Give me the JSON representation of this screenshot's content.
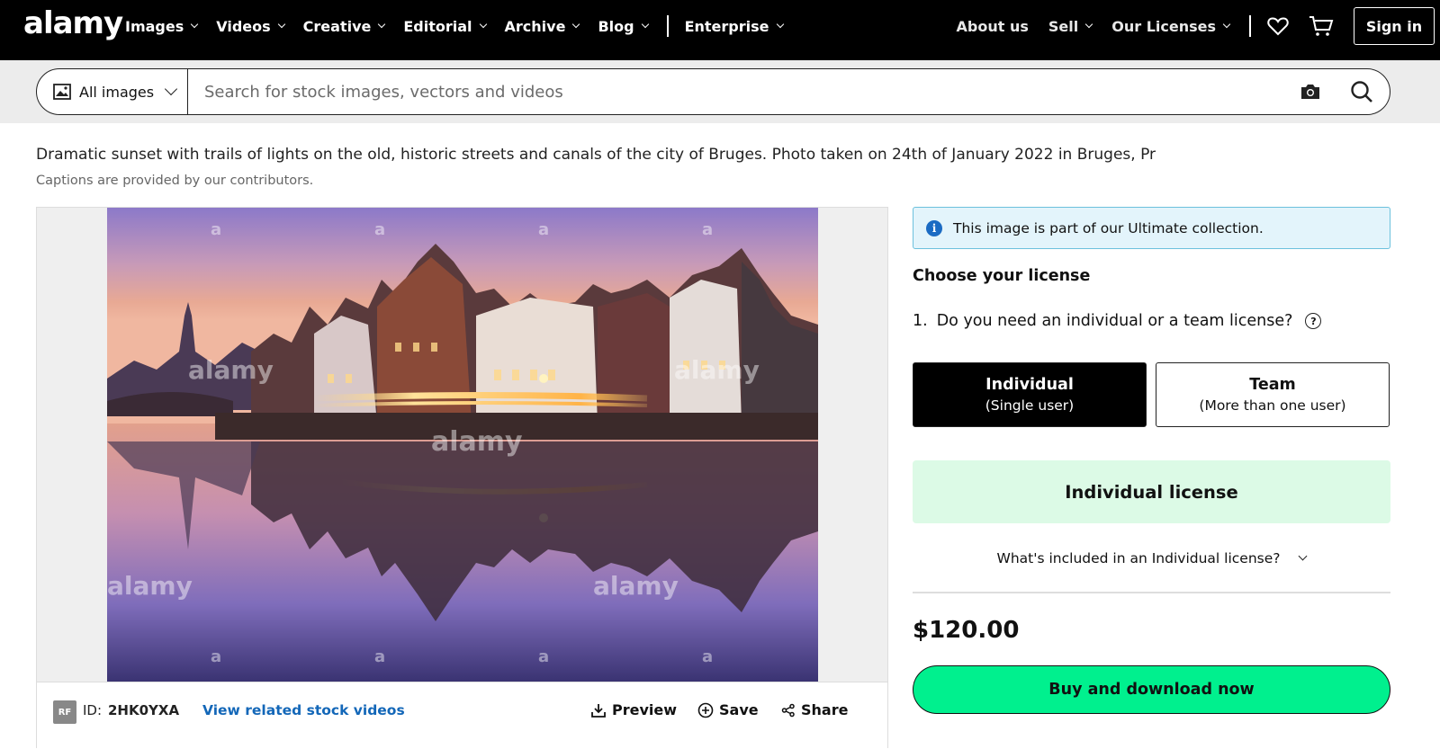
{
  "brand": {
    "logo_text": "alamy"
  },
  "nav": {
    "items": [
      {
        "label": "Images"
      },
      {
        "label": "Videos"
      },
      {
        "label": "Creative"
      },
      {
        "label": "Editorial"
      },
      {
        "label": "Archive"
      },
      {
        "label": "Blog"
      }
    ],
    "enterprise": "Enterprise",
    "about": "About us",
    "sell": "Sell",
    "licenses": "Our Licenses",
    "signin": "Sign in",
    "icons": [
      "heart-icon",
      "cart-icon"
    ]
  },
  "search": {
    "scope": "All images",
    "placeholder": "Search for stock images, vectors and videos",
    "value": ""
  },
  "caption": {
    "text": "Dramatic sunset with trails of lights on the old, historic streets and canals of the city of Bruges. Photo taken on 24th of January 2022 in Bruges, Pr",
    "note": "Captions are provided by our contributors."
  },
  "image": {
    "watermark": "alamy",
    "watermark_mark": "a",
    "badge": "RF",
    "id_label": "ID:",
    "id_value": "2HK0YXA",
    "related_link": "View related stock videos",
    "actions": {
      "preview": "Preview",
      "save": "Save",
      "share": "Share"
    }
  },
  "license": {
    "info": "This image is part of our Ultimate collection.",
    "heading": "Choose your license",
    "question_num": "1.",
    "question": "Do you need an individual or a team license?",
    "help": "?",
    "options": [
      {
        "title": "Individual",
        "sub": "(Single user)",
        "selected": true
      },
      {
        "title": "Team",
        "sub": "(More than one user)",
        "selected": false
      }
    ],
    "banner": "Individual license",
    "included": "What's included in an Individual license?",
    "price": "$120.00",
    "buy": "Buy and download now"
  },
  "colors": {
    "accent_green": "#00f08e",
    "banner_green": "#dcfae6",
    "info_blue": "#e3f4fb",
    "link_blue": "#1367b8"
  }
}
